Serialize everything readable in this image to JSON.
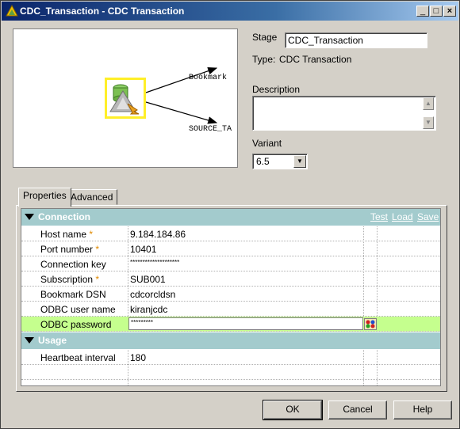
{
  "window": {
    "title": "CDC_Transaction - CDC Transaction",
    "minimize_glyph": "_",
    "maximize_glyph": "□",
    "close_glyph": "×"
  },
  "preview": {
    "link_top": "Bookmark",
    "link_bottom": "SOURCE_TA"
  },
  "stage": {
    "label": "Stage",
    "value": "CDC_Transaction",
    "type_label": "Type:",
    "type_value": "CDC Transaction"
  },
  "description": {
    "label": "Description",
    "value": ""
  },
  "variant": {
    "label": "Variant",
    "value": "6.5"
  },
  "tabs": [
    {
      "label": "Properties",
      "active": true
    },
    {
      "label": "Advanced",
      "active": false
    }
  ],
  "connection": {
    "title": "Connection",
    "actions": [
      "Test",
      "Load",
      "Save"
    ],
    "rows": [
      {
        "key": "Host name",
        "required": true,
        "value": "9.184.184.86"
      },
      {
        "key": "Port number",
        "required": true,
        "value": "10401"
      },
      {
        "key": "Connection key",
        "required": false,
        "value": "********************"
      },
      {
        "key": "Subscription",
        "required": true,
        "value": "SUB001"
      },
      {
        "key": "Bookmark DSN",
        "required": false,
        "value": "cdcorcldsn"
      },
      {
        "key": "ODBC user name",
        "required": false,
        "value": "kiranjcdc"
      },
      {
        "key": "ODBC password",
        "required": false,
        "value": "*********"
      }
    ]
  },
  "usage": {
    "title": "Usage",
    "rows": [
      {
        "key": "Heartbeat interval",
        "value": "180"
      }
    ]
  },
  "required_marker": "*",
  "buttons": {
    "ok": "OK",
    "cancel": "Cancel",
    "help": "Help"
  },
  "colors": {
    "category_header": "#a3cbcd",
    "selected_row": "#c5ff8e",
    "stage_highlight": "#ffef29"
  },
  "icons": [
    "app-icon",
    "transaction-stage-icon",
    "password-editor-icon",
    "triangle-down-icon"
  ]
}
